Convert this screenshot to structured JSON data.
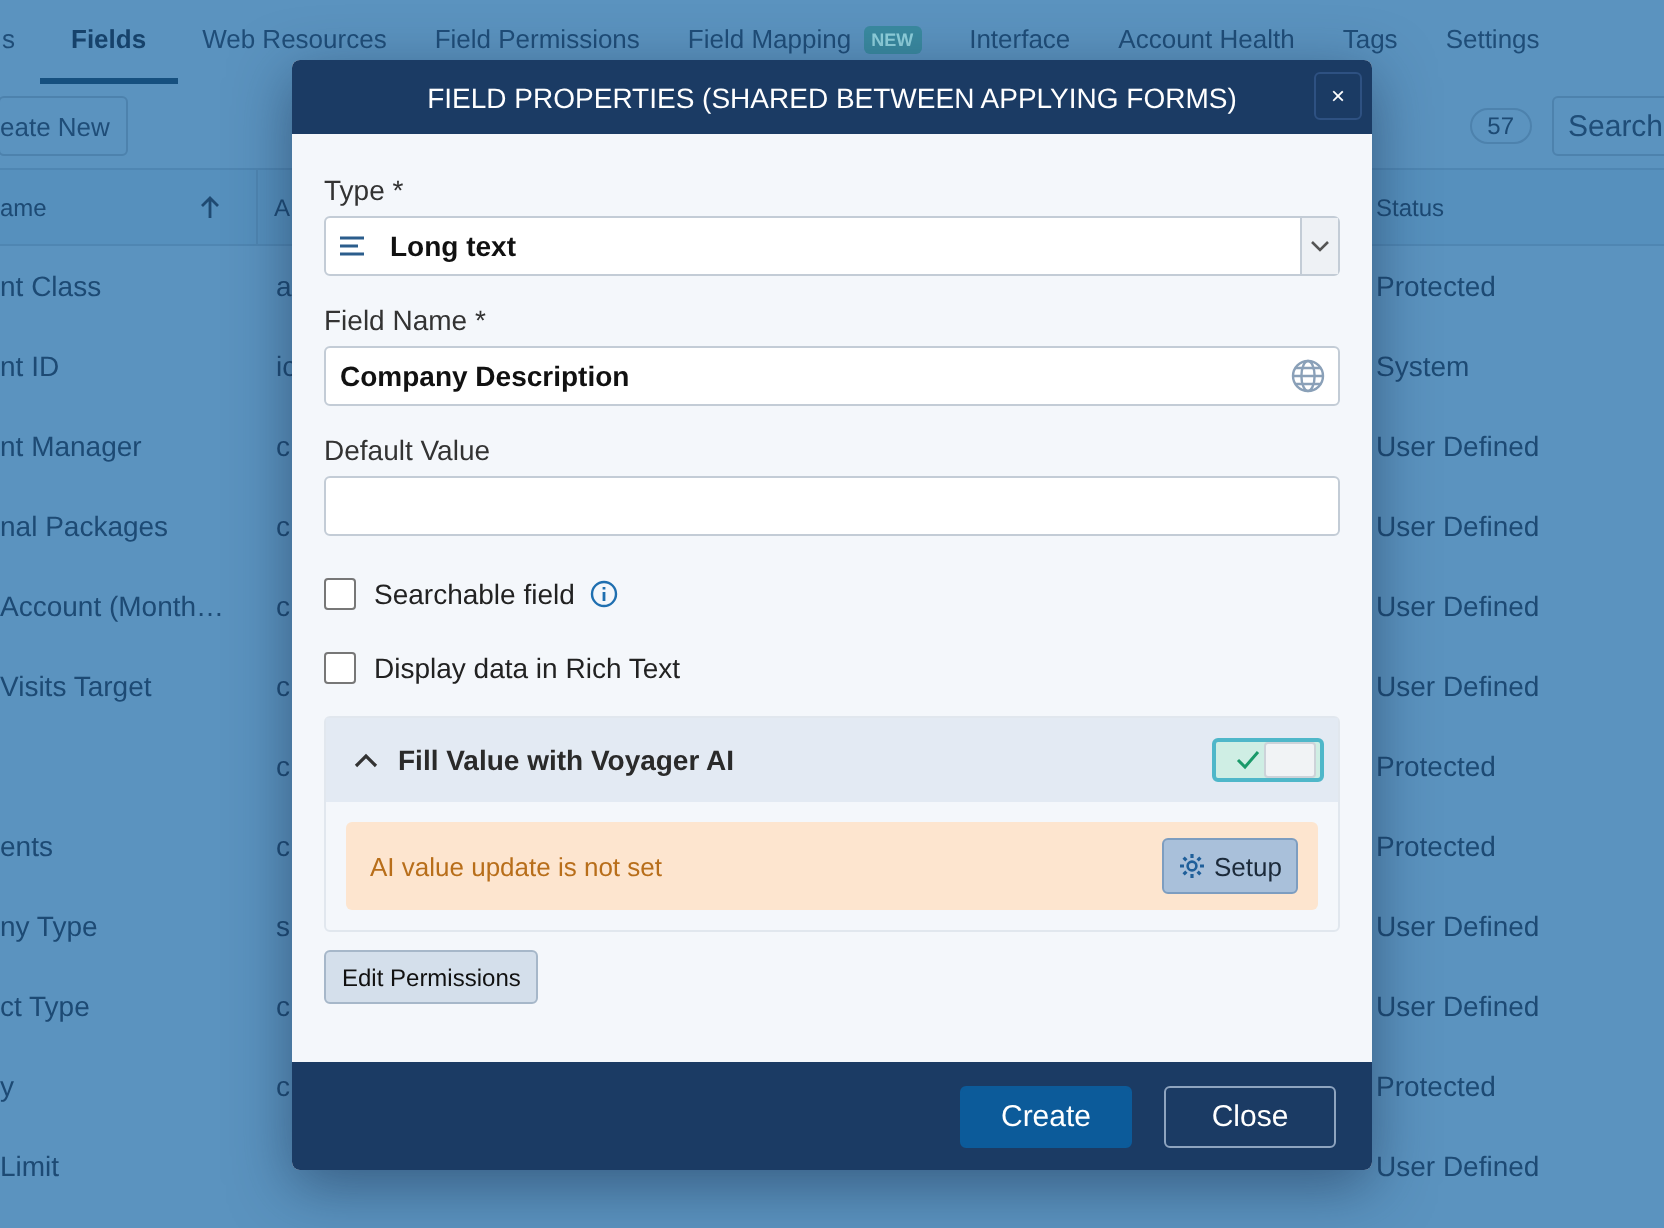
{
  "tabs": [
    {
      "label": "s",
      "selected": false
    },
    {
      "label": "Fields",
      "selected": true
    },
    {
      "label": "Web Resources",
      "selected": false
    },
    {
      "label": "Field Permissions",
      "selected": false
    },
    {
      "label": "Field Mapping",
      "selected": false,
      "badge": "NEW"
    },
    {
      "label": "Interface",
      "selected": false
    },
    {
      "label": "Account Health",
      "selected": false
    },
    {
      "label": "Tags",
      "selected": false
    },
    {
      "label": "Settings",
      "selected": false
    }
  ],
  "toolbar": {
    "create_button": "eate New",
    "count": "57",
    "search_button": "Search"
  },
  "table": {
    "columns": [
      "ame",
      "A",
      "Status"
    ],
    "rows": [
      {
        "name": "nt Class",
        "column_2": "a",
        "status": "Protected"
      },
      {
        "name": "nt ID",
        "column_2": "ic",
        "status": "System"
      },
      {
        "name": "nt Manager",
        "column_2": "c",
        "status": "User Defined"
      },
      {
        "name": "nal Packages",
        "column_2": "c",
        "status": "User Defined"
      },
      {
        "name": "Account (Month…",
        "column_2": "c",
        "status": "User Defined"
      },
      {
        "name": "Visits Target",
        "column_2": "c",
        "status": "User Defined"
      },
      {
        "name": "",
        "column_2": "c",
        "status": "Protected"
      },
      {
        "name": "ents",
        "column_2": "c",
        "status": "Protected"
      },
      {
        "name": "ny Type",
        "column_2": "s",
        "status": "User Defined"
      },
      {
        "name": "ct Type",
        "column_2": "c",
        "status": "User Defined"
      },
      {
        "name": "y",
        "column_2": "c",
        "status": "Protected"
      },
      {
        "name": "Limit",
        "status": "User Defined"
      }
    ]
  },
  "dialog": {
    "title": "FIELD PROPERTIES (SHARED BETWEEN APPLYING FORMS)",
    "close": "×",
    "type": {
      "label": "Type *",
      "value": "Long text"
    },
    "field_name": {
      "label": "Field Name *",
      "value": "Company Description"
    },
    "default_value": {
      "label": "Default Value"
    },
    "checkboxes": [
      {
        "label": "Searchable field",
        "checked": false,
        "info": true
      },
      {
        "label": "Display data in Rich Text",
        "checked": false,
        "info": false
      }
    ],
    "ai_panel": {
      "title": "Fill Value with Voyager AI",
      "expanded": true,
      "on": true,
      "warning": "AI value update is not set",
      "setup_button": "Setup"
    },
    "edit_permissions": "Edit Permissions",
    "buttons": [
      {
        "label": "Create",
        "kind": "primary"
      },
      {
        "label": "Close",
        "kind": "secondary"
      }
    ]
  }
}
